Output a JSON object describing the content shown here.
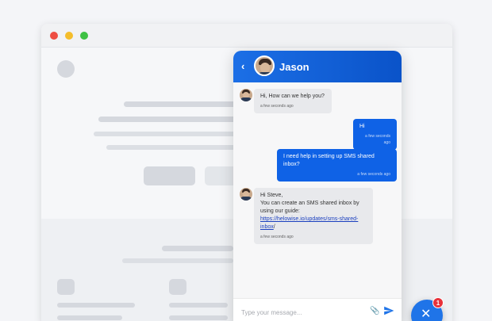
{
  "chat": {
    "agent_name": "Jason",
    "composer_placeholder": "Type your message...",
    "messages": [
      {
        "direction": "in",
        "text": "Hi, How can we help you?",
        "time": "a few seconds ago"
      },
      {
        "direction": "out",
        "text": "Hi",
        "time": "a few seconds ago"
      },
      {
        "direction": "out",
        "text": "I need help in setting up SMS shared inbox?",
        "time": "a few seconds ago"
      },
      {
        "direction": "in",
        "line1": "Hi Steve,",
        "line2": "You can create an SMS shared inbox by using our guide:",
        "link_text": "https://helowise.io/updates/sms-shared-inbox",
        "suffix": "/",
        "time": "a few seconds ago"
      }
    ]
  },
  "launcher": {
    "badge_count": "1"
  },
  "colors": {
    "accent": "#0f62e6",
    "header_start": "#1c6fe6",
    "header_end": "#0a53c9",
    "badge": "#e8323a"
  }
}
